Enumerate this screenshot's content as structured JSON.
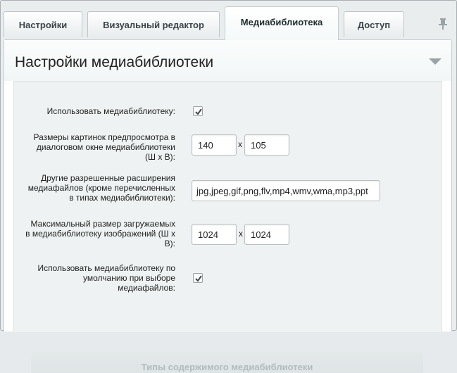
{
  "tabs": [
    {
      "label": "Настройки"
    },
    {
      "label": "Визуальный редактор"
    },
    {
      "label": "Медиабиблиотека"
    },
    {
      "label": "Доступ"
    }
  ],
  "active_tab": "Медиабиблиотека",
  "panel": {
    "title": "Настройки медиабиблиотеки"
  },
  "form": {
    "use_medialib": {
      "label": "Использовать медиабиблиотеку:",
      "checked": true
    },
    "preview_size": {
      "label_lines": [
        "Размеры картинок предпросмотра в",
        "диалоговом окне медиабиблиотеки",
        "(Ш x В):"
      ],
      "width": "140",
      "separator": "x",
      "height": "105"
    },
    "extensions": {
      "label_lines": [
        "Другие разрешенные расширения",
        "медиафайлов (кроме перечисленных",
        "в типах медиабиблиотеки):"
      ],
      "value": "jpg,jpeg,gif,png,flv,mp4,wmv,wma,mp3,ppt"
    },
    "max_size": {
      "label_lines": [
        "Максимальный размер загружаемых",
        "в медиабиблиотеку изображений (Ш x",
        "В):"
      ],
      "width": "1024",
      "separator": "x",
      "height": "1024"
    },
    "use_default": {
      "label_lines": [
        "Использовать медиабиблиотеку по",
        "умолчанию при выборе",
        "медиафайлов:"
      ],
      "checked": true
    }
  },
  "section": {
    "title": "Типы содержимого медиабиблиотеки"
  }
}
